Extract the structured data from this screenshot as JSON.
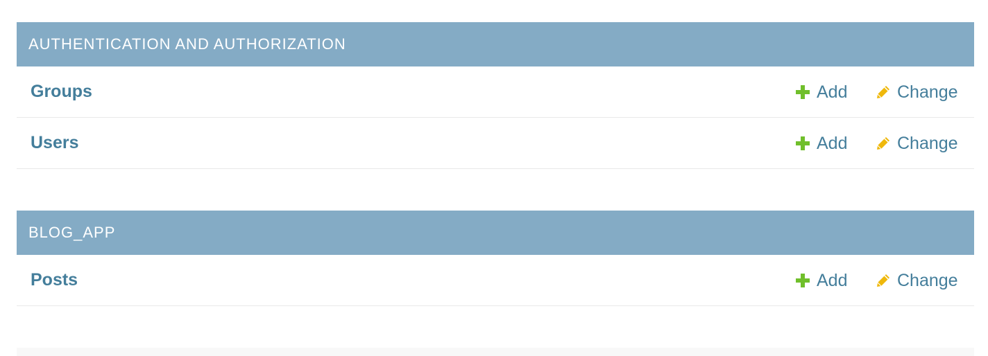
{
  "modules": [
    {
      "caption": "AUTHENTICATION AND AUTHORIZATION",
      "models": [
        {
          "name": "Groups",
          "add_label": "Add",
          "change_label": "Change"
        },
        {
          "name": "Users",
          "add_label": "Add",
          "change_label": "Change"
        }
      ]
    },
    {
      "caption": "BLOG_APP",
      "models": [
        {
          "name": "Posts",
          "add_label": "Add",
          "change_label": "Change"
        }
      ]
    }
  ],
  "colors": {
    "header_bg": "#84abc5",
    "link": "#447e9b",
    "add_icon": "#70bf2b",
    "change_icon": "#efb80b"
  },
  "icons": {
    "add": "plus-icon",
    "change": "pencil-icon"
  }
}
